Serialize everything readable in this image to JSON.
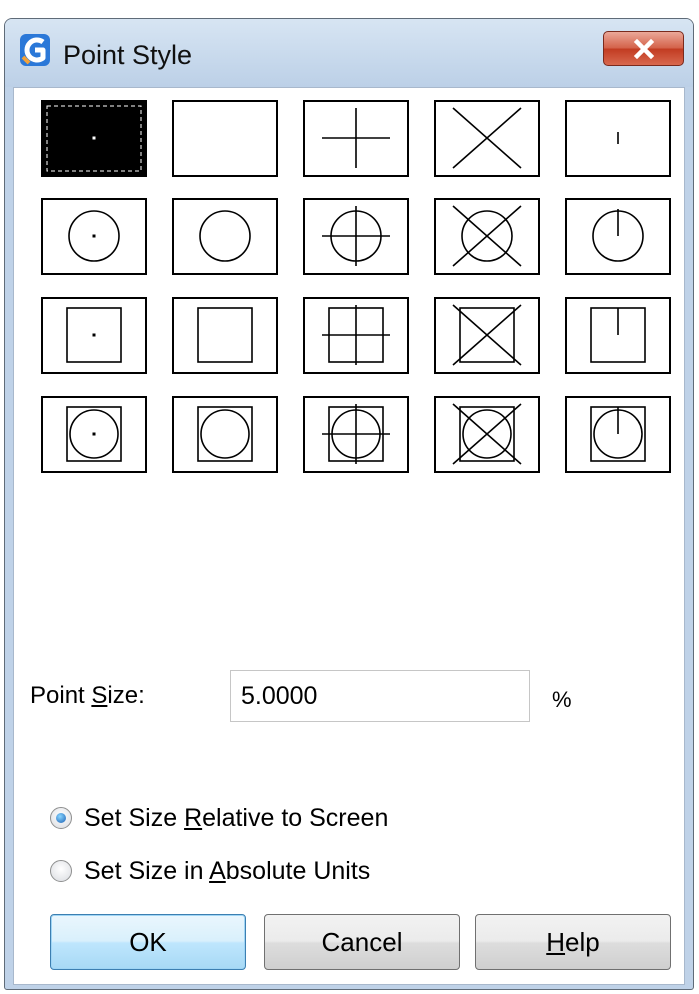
{
  "window": {
    "title": "Point Style",
    "app_icon": "gstarcad-logo-icon",
    "close_icon": "close-x-icon"
  },
  "point_styles": {
    "selected_index": 0,
    "tiles": [
      {
        "icon": "point-dot-icon"
      },
      {
        "icon": "point-none-icon"
      },
      {
        "icon": "point-plus-icon"
      },
      {
        "icon": "point-x-icon"
      },
      {
        "icon": "point-tick-icon"
      },
      {
        "icon": "circle-dot-icon"
      },
      {
        "icon": "circle-icon"
      },
      {
        "icon": "circle-plus-icon"
      },
      {
        "icon": "circle-x-icon"
      },
      {
        "icon": "circle-tick-icon"
      },
      {
        "icon": "square-dot-icon"
      },
      {
        "icon": "square-icon"
      },
      {
        "icon": "square-plus-icon"
      },
      {
        "icon": "square-x-icon"
      },
      {
        "icon": "square-tick-icon"
      },
      {
        "icon": "square-circle-dot-icon"
      },
      {
        "icon": "square-circle-icon"
      },
      {
        "icon": "square-circle-plus-icon"
      },
      {
        "icon": "square-circle-x-icon"
      },
      {
        "icon": "square-circle-tick-icon"
      }
    ]
  },
  "point_size": {
    "label_prefix": "Point ",
    "label_mnemonic": "S",
    "label_suffix": "ize:",
    "value": "5.0000",
    "unit": "%"
  },
  "size_mode": {
    "options": [
      {
        "prefix": "Set Size ",
        "mnemonic": "R",
        "suffix": "elative to Screen",
        "checked": true
      },
      {
        "prefix": "Set Size in ",
        "mnemonic": "A",
        "suffix": "bsolute Units",
        "checked": false
      }
    ]
  },
  "buttons": {
    "ok": "OK",
    "cancel": "Cancel",
    "help_mnemonic": "H",
    "help_suffix": "elp"
  },
  "colors": {
    "title_bar": "#bfd2e8",
    "close_button": "#c94a31",
    "selected_tile": "#000000",
    "default_button_border": "#3c7fb1"
  }
}
